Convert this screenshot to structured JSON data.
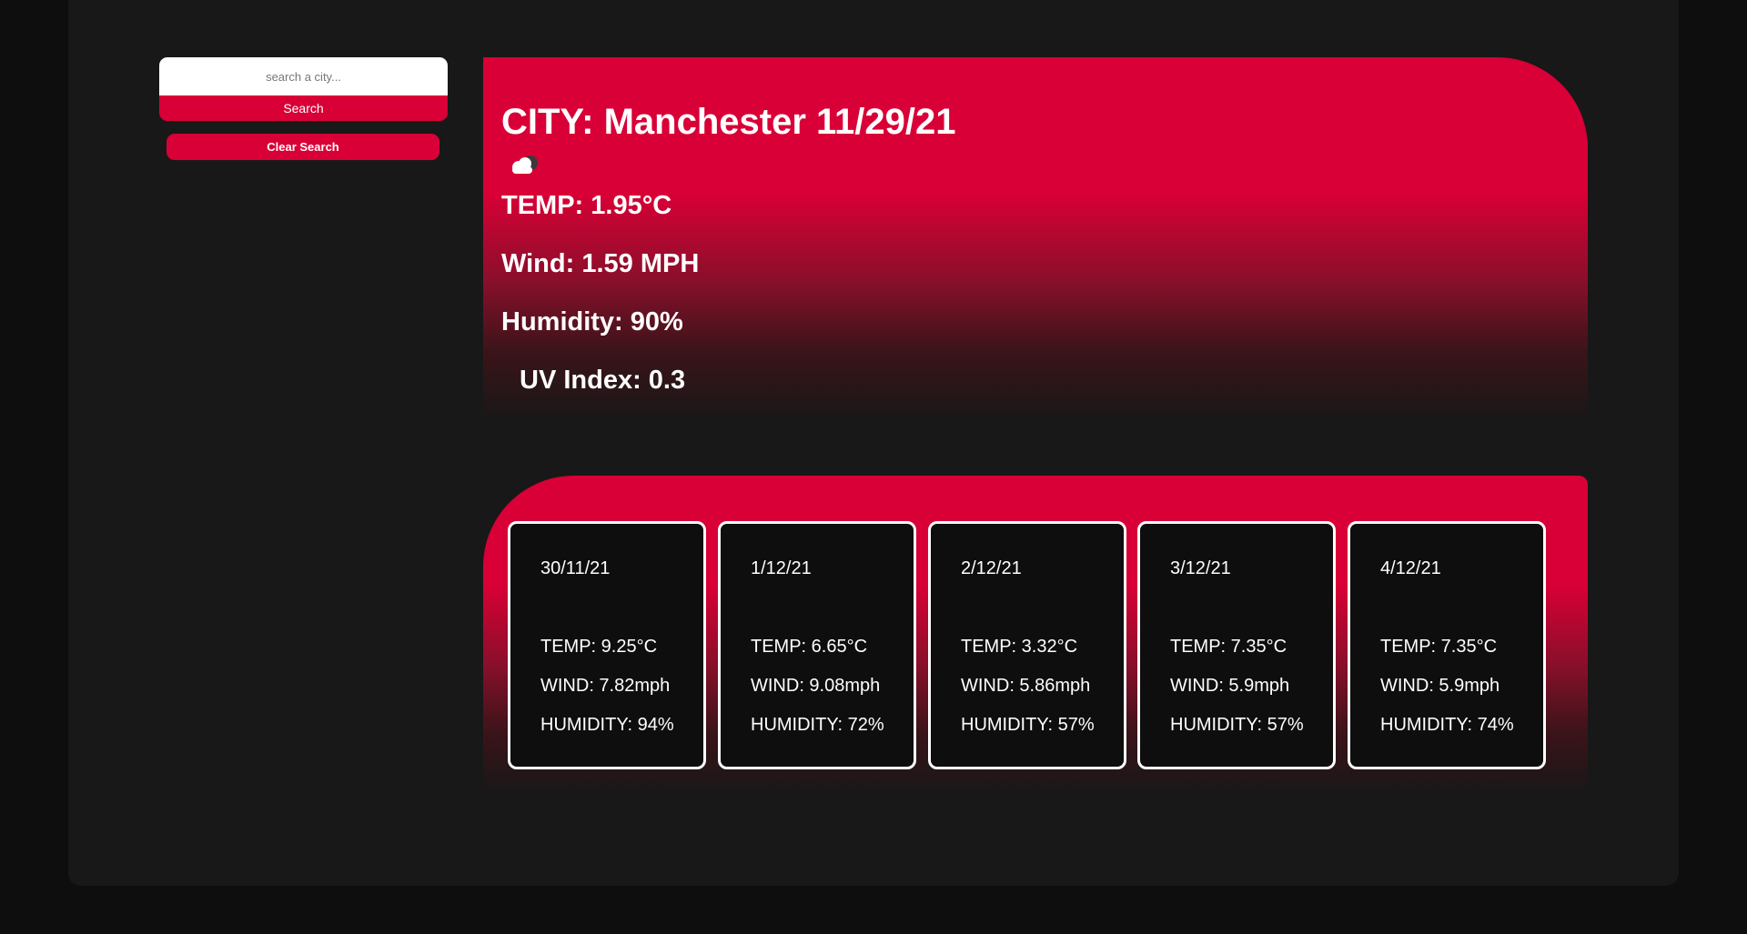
{
  "search": {
    "placeholder": "search a city...",
    "button_label": "Search",
    "clear_label": "Clear Search"
  },
  "current": {
    "heading": "CITY: Manchester 11/29/21",
    "icon": "cloud-icon",
    "temp": "TEMP: 1.95°C",
    "wind": "Wind: 1.59 MPH",
    "humidity": "Humidity: 90%",
    "uv": "UV Index: 0.3"
  },
  "forecast": [
    {
      "date": "30/11/21",
      "temp": "TEMP: 9.25°C",
      "wind": "WIND: 7.82mph",
      "humidity": "HUMIDITY: 94%"
    },
    {
      "date": "1/12/21",
      "temp": "TEMP: 6.65°C",
      "wind": "WIND: 9.08mph",
      "humidity": "HUMIDITY: 72%"
    },
    {
      "date": "2/12/21",
      "temp": "TEMP: 3.32°C",
      "wind": "WIND: 5.86mph",
      "humidity": "HUMIDITY: 57%"
    },
    {
      "date": "3/12/21",
      "temp": "TEMP: 7.35°C",
      "wind": "WIND: 5.9mph",
      "humidity": "HUMIDITY: 57%"
    },
    {
      "date": "4/12/21",
      "temp": "TEMP: 7.35°C",
      "wind": "WIND: 5.9mph",
      "humidity": "HUMIDITY: 74%"
    }
  ],
  "colors": {
    "accent": "#d80036",
    "background": "#181818",
    "page": "#0e0e0e",
    "card": "#0e0e0e"
  }
}
